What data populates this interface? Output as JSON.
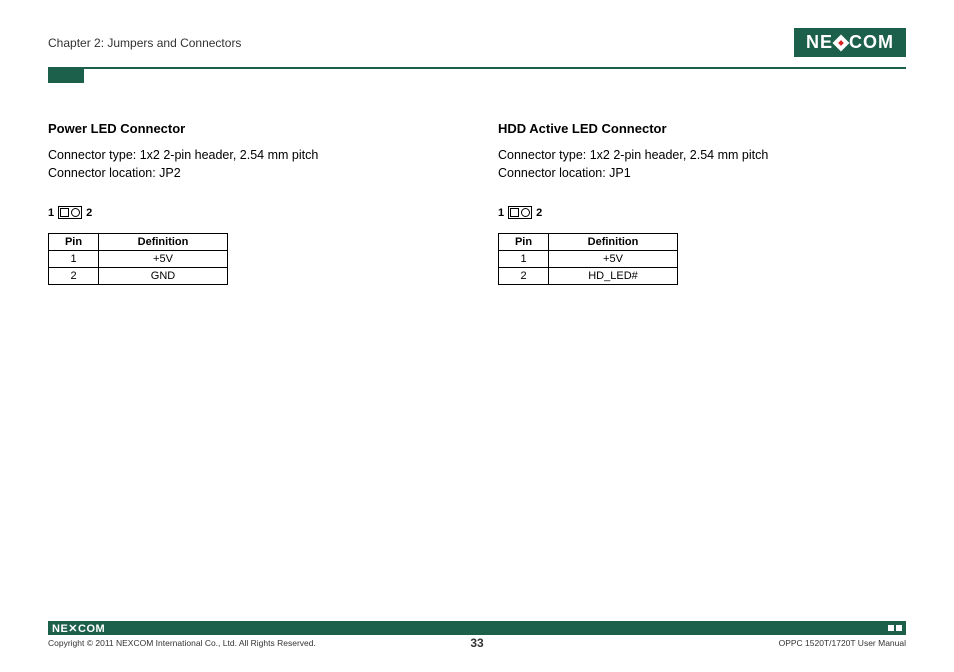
{
  "header": {
    "chapter": "Chapter 2: Jumpers and Connectors",
    "brand_pre": "NE",
    "brand_post": "COM"
  },
  "left": {
    "title": "Power LED Connector",
    "type_line": "Connector type: 1x2 2-pin header, 2.54 mm pitch",
    "loc_line": "Connector location: JP2",
    "pin_left": "1",
    "pin_right": "2",
    "table": {
      "h1": "Pin",
      "h2": "Definition",
      "rows": [
        {
          "pin": "1",
          "def": "+5V"
        },
        {
          "pin": "2",
          "def": "GND"
        }
      ]
    }
  },
  "right": {
    "title": "HDD Active LED Connector",
    "type_line": "Connector type: 1x2 2-pin header, 2.54 mm pitch",
    "loc_line": "Connector location: JP1",
    "pin_left": "1",
    "pin_right": "2",
    "table": {
      "h1": "Pin",
      "h2": "Definition",
      "rows": [
        {
          "pin": "1",
          "def": "+5V"
        },
        {
          "pin": "2",
          "def": "HD_LED#"
        }
      ]
    }
  },
  "footer": {
    "brand_pre": "NE",
    "brand_post": "COM",
    "copyright": "Copyright © 2011 NEXCOM International Co., Ltd. All Rights Reserved.",
    "page": "33",
    "doc": "OPPC 1520T/1720T User Manual"
  }
}
